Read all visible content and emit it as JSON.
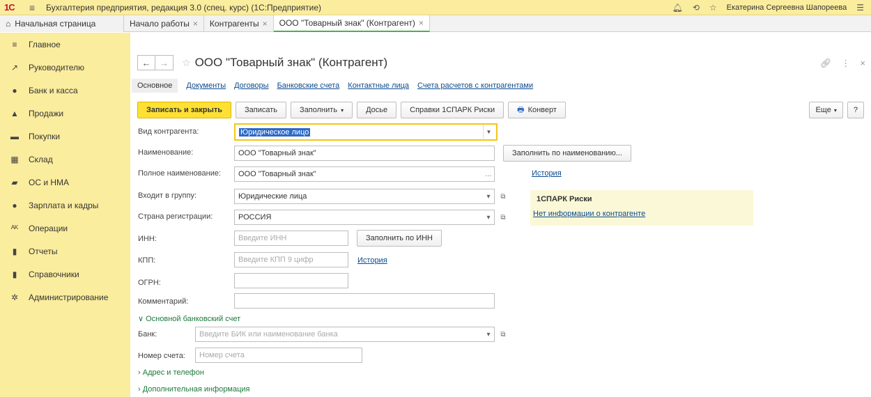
{
  "titlebar": {
    "logo": "1С",
    "app_title": "Бухгалтерия предприятия, редакция 3.0 (спец. курс) (1С:Предприятие)",
    "user": "Екатерина Сергеевна Шапореева"
  },
  "tabs": [
    {
      "label": "Начальная страница"
    },
    {
      "label": "Начало работы"
    },
    {
      "label": "Контрагенты"
    },
    {
      "label": "ООО \"Товарный знак\" (Контрагент)"
    }
  ],
  "sidebar": {
    "items": [
      {
        "label": "Главное",
        "icon": "≡"
      },
      {
        "label": "Руководителю",
        "icon": "↗"
      },
      {
        "label": "Банк и касса",
        "icon": "●"
      },
      {
        "label": "Продажи",
        "icon": "▲"
      },
      {
        "label": "Покупки",
        "icon": "▬"
      },
      {
        "label": "Склад",
        "icon": "▦"
      },
      {
        "label": "ОС и НМА",
        "icon": "▰"
      },
      {
        "label": "Зарплата и кадры",
        "icon": "●"
      },
      {
        "label": "Операции",
        "icon": "ᴬᴷ"
      },
      {
        "label": "Отчеты",
        "icon": "▮"
      },
      {
        "label": "Справочники",
        "icon": "▮"
      },
      {
        "label": "Администрирование",
        "icon": "✲"
      }
    ]
  },
  "form": {
    "title": "ООО \"Товарный знак\" (Контрагент)",
    "sections": {
      "main": "Основное",
      "documents": "Документы",
      "contracts": "Договоры",
      "bank_accounts": "Банковские счета",
      "contacts": "Контактные лица",
      "settlement_accounts": "Счета расчетов с контрагентами"
    },
    "toolbar": {
      "save_close": "Записать и закрыть",
      "save": "Записать",
      "fill": "Заполнить",
      "dossier": "Досье",
      "spark": "Справки 1СПАРК Риски",
      "envelope": "Конверт",
      "more": "Еще",
      "help": "?"
    },
    "fields": {
      "kind_label": "Вид контрагента:",
      "kind_value": "Юридическое лицо",
      "name_label": "Наименование:",
      "name_value": "ООО \"Товарный знак\"",
      "fill_by_name": "Заполнить по наименованию...",
      "fullname_label": "Полное наименование:",
      "fullname_value": "ООО \"Товарный знак\"",
      "history": "История",
      "group_label": "Входит в группу:",
      "group_value": "Юридические лица",
      "country_label": "Страна регистрации:",
      "country_value": "РОССИЯ",
      "inn_label": "ИНН:",
      "inn_placeholder": "Введите ИНН",
      "fill_by_inn": "Заполнить по ИНН",
      "kpp_label": "КПП:",
      "kpp_placeholder": "Введите КПП 9 цифр",
      "ogrn_label": "ОГРН:",
      "comment_label": "Комментарий:",
      "bank_group": "Основной банковский счет",
      "bank_label": "Банк:",
      "bank_placeholder": "Введите БИК или наименование банка",
      "account_label": "Номер счета:",
      "account_placeholder": "Номер счета",
      "address_group": "Адрес и телефон",
      "additional_group": "Дополнительная информация"
    },
    "spark": {
      "title": "1СПАРК Риски",
      "link": "Нет информации о контрагенте"
    }
  }
}
